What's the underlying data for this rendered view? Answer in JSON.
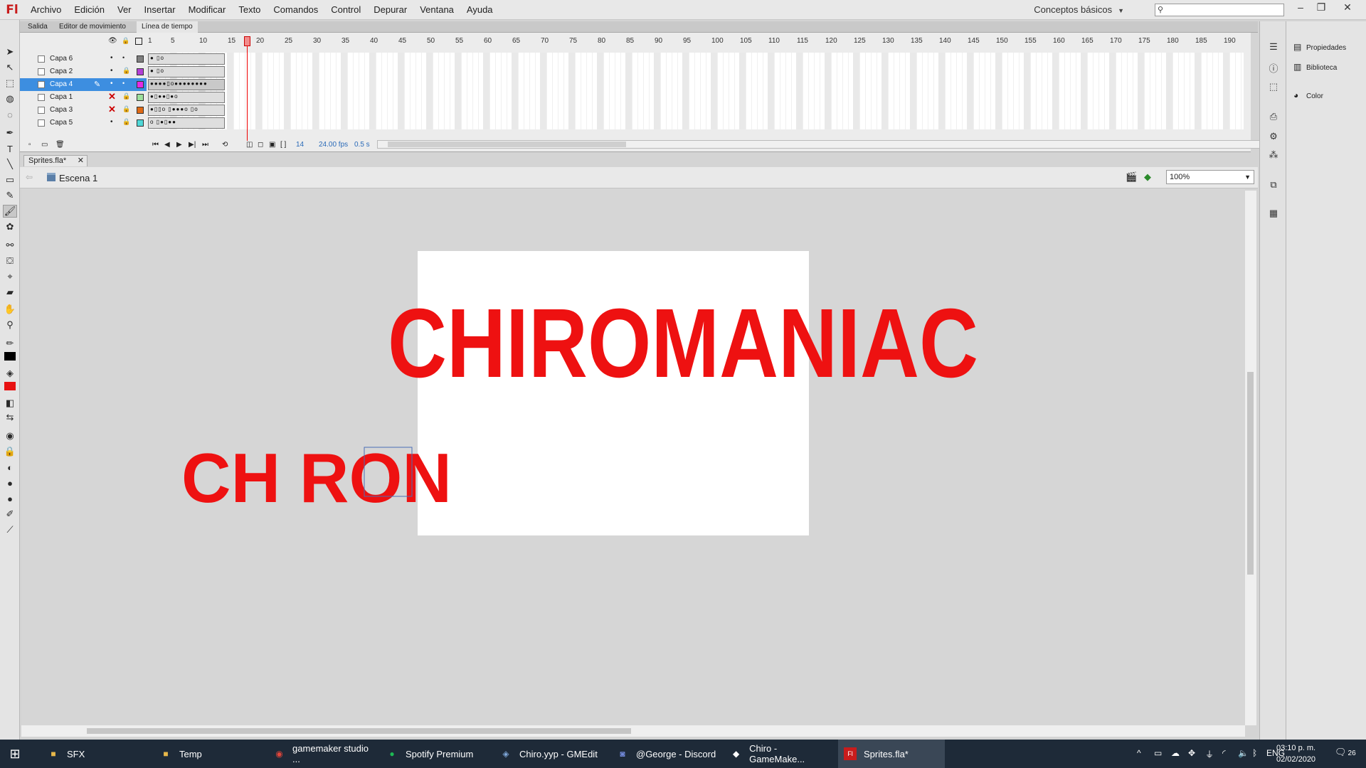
{
  "app": {
    "logo": "Fl"
  },
  "menu": [
    "Archivo",
    "Edición",
    "Ver",
    "Insertar",
    "Modificar",
    "Texto",
    "Comandos",
    "Control",
    "Depurar",
    "Ventana",
    "Ayuda"
  ],
  "workspace": {
    "label": "Conceptos básicos"
  },
  "search": {
    "value": ""
  },
  "panel_tabs": [
    "Salida",
    "Editor de movimiento",
    "Línea de tiempo"
  ],
  "timeline": {
    "ruler": [
      "1",
      "5",
      "10",
      "15",
      "20",
      "25",
      "30",
      "35",
      "40",
      "45",
      "50",
      "55",
      "60",
      "65",
      "70",
      "75",
      "80",
      "85",
      "90",
      "95",
      "100",
      "105",
      "110",
      "115",
      "120",
      "125",
      "130",
      "135",
      "140",
      "145",
      "150",
      "155",
      "160",
      "165",
      "170",
      "175",
      "180",
      "185",
      "190"
    ],
    "layers": [
      {
        "name": "Capa 6",
        "visible": true,
        "color": "#7f7f7f",
        "frames": "●  ▯o"
      },
      {
        "name": "Capa 2",
        "visible": true,
        "color": "#b23fd6",
        "frames": "●  ▯o"
      },
      {
        "name": "Capa 4",
        "visible": true,
        "color": "#e62ae6",
        "selected": true,
        "frames": "●●●●▯o●●●●●●●●"
      },
      {
        "name": "Capa 1",
        "visible": false,
        "color": "#9de09d",
        "frames": "●▯●●▯●o"
      },
      {
        "name": "Capa 3",
        "visible": false,
        "color": "#e06a16",
        "frames": "●▯▯o ▯●●●o ▯o"
      },
      {
        "name": "Capa 5",
        "visible": true,
        "color": "#4fd8d8",
        "frames": "o ▯●▯●●"
      }
    ],
    "current_frame": "14",
    "fps": "24.00 fps",
    "time": "0.5 s"
  },
  "document": {
    "tab": "Sprites.fla*",
    "scene": "Escena 1",
    "zoom": "100%"
  },
  "canvas": {
    "big_text": "CHIROMANIAC",
    "small_text": "CH RON",
    "stroke_color": "#ee1111"
  },
  "right_panel": [
    "Propiedades",
    "Biblioteca",
    "Color"
  ],
  "taskbar": {
    "items": [
      {
        "label": "SFX",
        "icon": "folder-icon",
        "color": "#e8b84a"
      },
      {
        "label": "Temp",
        "icon": "folder-icon",
        "color": "#e8b84a"
      },
      {
        "label": "gamemaker studio ...",
        "icon": "chrome-icon",
        "color": "#e0453a"
      },
      {
        "label": "Spotify Premium",
        "icon": "spotify-icon",
        "color": "#1db954"
      },
      {
        "label": "Chiro.yyp - GMEdit",
        "icon": "gmedit-icon",
        "color": "#7fa7d9"
      },
      {
        "label": "@George - Discord",
        "icon": "discord-icon",
        "color": "#7289da"
      },
      {
        "label": "Chiro - GameMake...",
        "icon": "gamemaker-icon",
        "color": "#ffffff"
      },
      {
        "label": "Sprites.fla*",
        "icon": "flash-icon",
        "color": "#c81c1c"
      }
    ],
    "tray": {
      "lang": "ENG",
      "time": "03:10 p. m.",
      "date": "02/02/2020",
      "notifications": "26"
    }
  }
}
